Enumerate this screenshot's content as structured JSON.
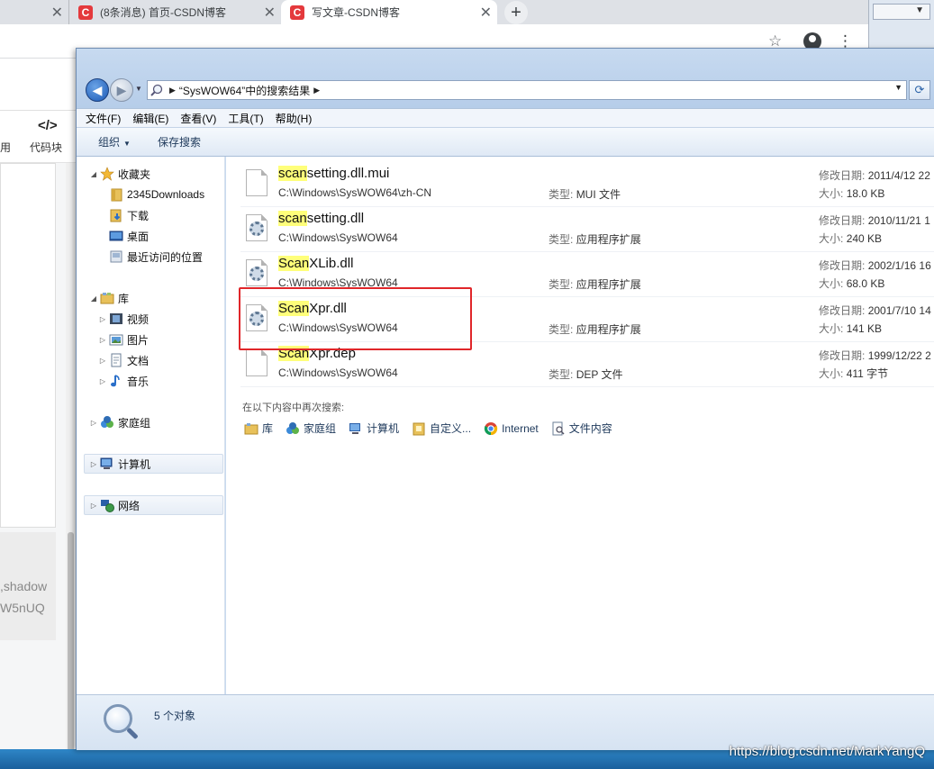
{
  "browser": {
    "tabs": [
      {
        "label": ""
      },
      {
        "label": "(8条消息) 首页-CSDN博客"
      },
      {
        "label": "写文章-CSDN博客"
      }
    ],
    "favicon_letter": "C",
    "close_glyph": "✕",
    "new_tab_glyph": "+"
  },
  "left_page": {
    "tool_left_label": "用",
    "tool_right_label": "代码块",
    "tool_right_icon": "</>",
    "partial_line_1": ",shadow",
    "partial_line_2": "W5nUQ"
  },
  "explorer": {
    "address": {
      "path_text": "“SysWOW64”中的搜索结果"
    },
    "menu": [
      "文件(F)",
      "编辑(E)",
      "查看(V)",
      "工具(T)",
      "帮助(H)"
    ],
    "commands": {
      "organize": "组织",
      "save_search": "保存搜索"
    },
    "sidebar": {
      "favorites": "收藏夹",
      "fav_items": [
        "2345Downloads",
        "下载",
        "桌面",
        "最近访问的位置"
      ],
      "libraries": "库",
      "lib_items": [
        "视频",
        "图片",
        "文档",
        "音乐"
      ],
      "homegroup": "家庭组",
      "computer": "计算机",
      "network": "网络"
    },
    "type_label": "类型:",
    "date_label": "修改日期:",
    "size_label": "大小:",
    "files": [
      {
        "highlight": "scan",
        "rest": "setting.dll.mui",
        "path": "C:\\Windows\\SysWOW64\\zh-CN",
        "type": "MUI 文件",
        "date": "2011/4/12 22",
        "size": "18.0 KB",
        "icon": "blank-file-icon"
      },
      {
        "highlight": "scan",
        "rest": "setting.dll",
        "path": "C:\\Windows\\SysWOW64",
        "type": "应用程序扩展",
        "date": "2010/11/21 1",
        "size": "240 KB",
        "icon": "dll-file-icon"
      },
      {
        "highlight": "Scan",
        "rest": "XLib.dll",
        "path": "C:\\Windows\\SysWOW64",
        "type": "应用程序扩展",
        "date": "2002/1/16 16",
        "size": "68.0 KB",
        "icon": "dll-file-icon"
      },
      {
        "highlight": "Scan",
        "rest": "Xpr.dll",
        "path": "C:\\Windows\\SysWOW64",
        "type": "应用程序扩展",
        "date": "2001/7/10 14",
        "size": "141 KB",
        "icon": "dll-file-icon"
      },
      {
        "highlight": "Scan",
        "rest": "Xpr.dep",
        "path": "C:\\Windows\\SysWOW64",
        "type": "DEP 文件",
        "date": "1999/12/22 2",
        "size": "411 字节",
        "icon": "blank-file-icon"
      }
    ],
    "search_again": {
      "label": "在以下内容中再次搜索:",
      "items": [
        "库",
        "家庭组",
        "计算机",
        "自定义...",
        "Internet",
        "文件内容"
      ]
    },
    "status": {
      "count_text": "5 个对象"
    },
    "highlight_color": "#ffff7a",
    "annotation_color": "#e0262a"
  },
  "watermark": "https://blog.csdn.net/MarkYangQ"
}
